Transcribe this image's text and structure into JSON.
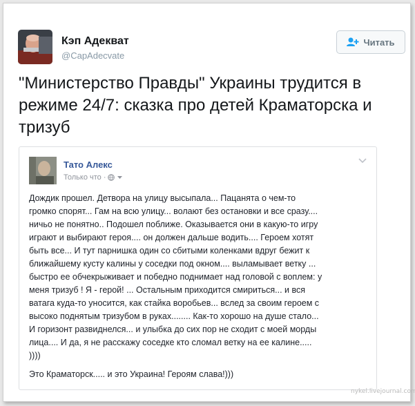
{
  "tweet": {
    "author_name": "Кэп Адекват",
    "author_handle": "@CapAdecvate",
    "follow_label": "Читать",
    "text": "\"Министерство Правды\" Украины трудится в режиме 24/7: сказка про детей Краматорска и тризуб"
  },
  "embed": {
    "author_name": "Тато Алекс",
    "meta": "Только что ·",
    "body": "Дождик прошел. Детвора на улицу высыпала... Пацанята о чем-то\nгромко спорят... Гам на всю улицу... волают без остановки и все сразу....\nничьо не понятно.. Подошел поближе. Оказывается они в какую-то игру\nиграют и выбирают героя.... он должен дальше водить.... Героем хотят\nбыть все... И тут парнишка один со сбитыми коленками вдруг бежит к\nближайшему кусту калины у соседки под окном.... выламывает ветку ...\nбыстро ее обчекрыживает и победно поднимает над головой с воплем: у\nменя тризуб ! Я - герой! ... Остальным приходится смириться... и вся\nватага куда-то уносится, как стайка воробьев... вслед за своим героем с\nвысоко поднятым тризубом в руках........ Как-то хорошо на душе стало...\nИ горизонт развиднелся... и улыбка до сих пор не сходит с моей морды\nлица.... И да, я не расскажу соседке кто сломал ветку на ее калине.....\n))))",
    "footer": "Это Краматорск..... и это Украина! Героям слава!)))"
  },
  "watermark": "nykel.livejournal.com",
  "colors": {
    "fb_link": "#365899",
    "twitter_gray": "#8899a6",
    "follow_icon": "#1da1f2"
  }
}
